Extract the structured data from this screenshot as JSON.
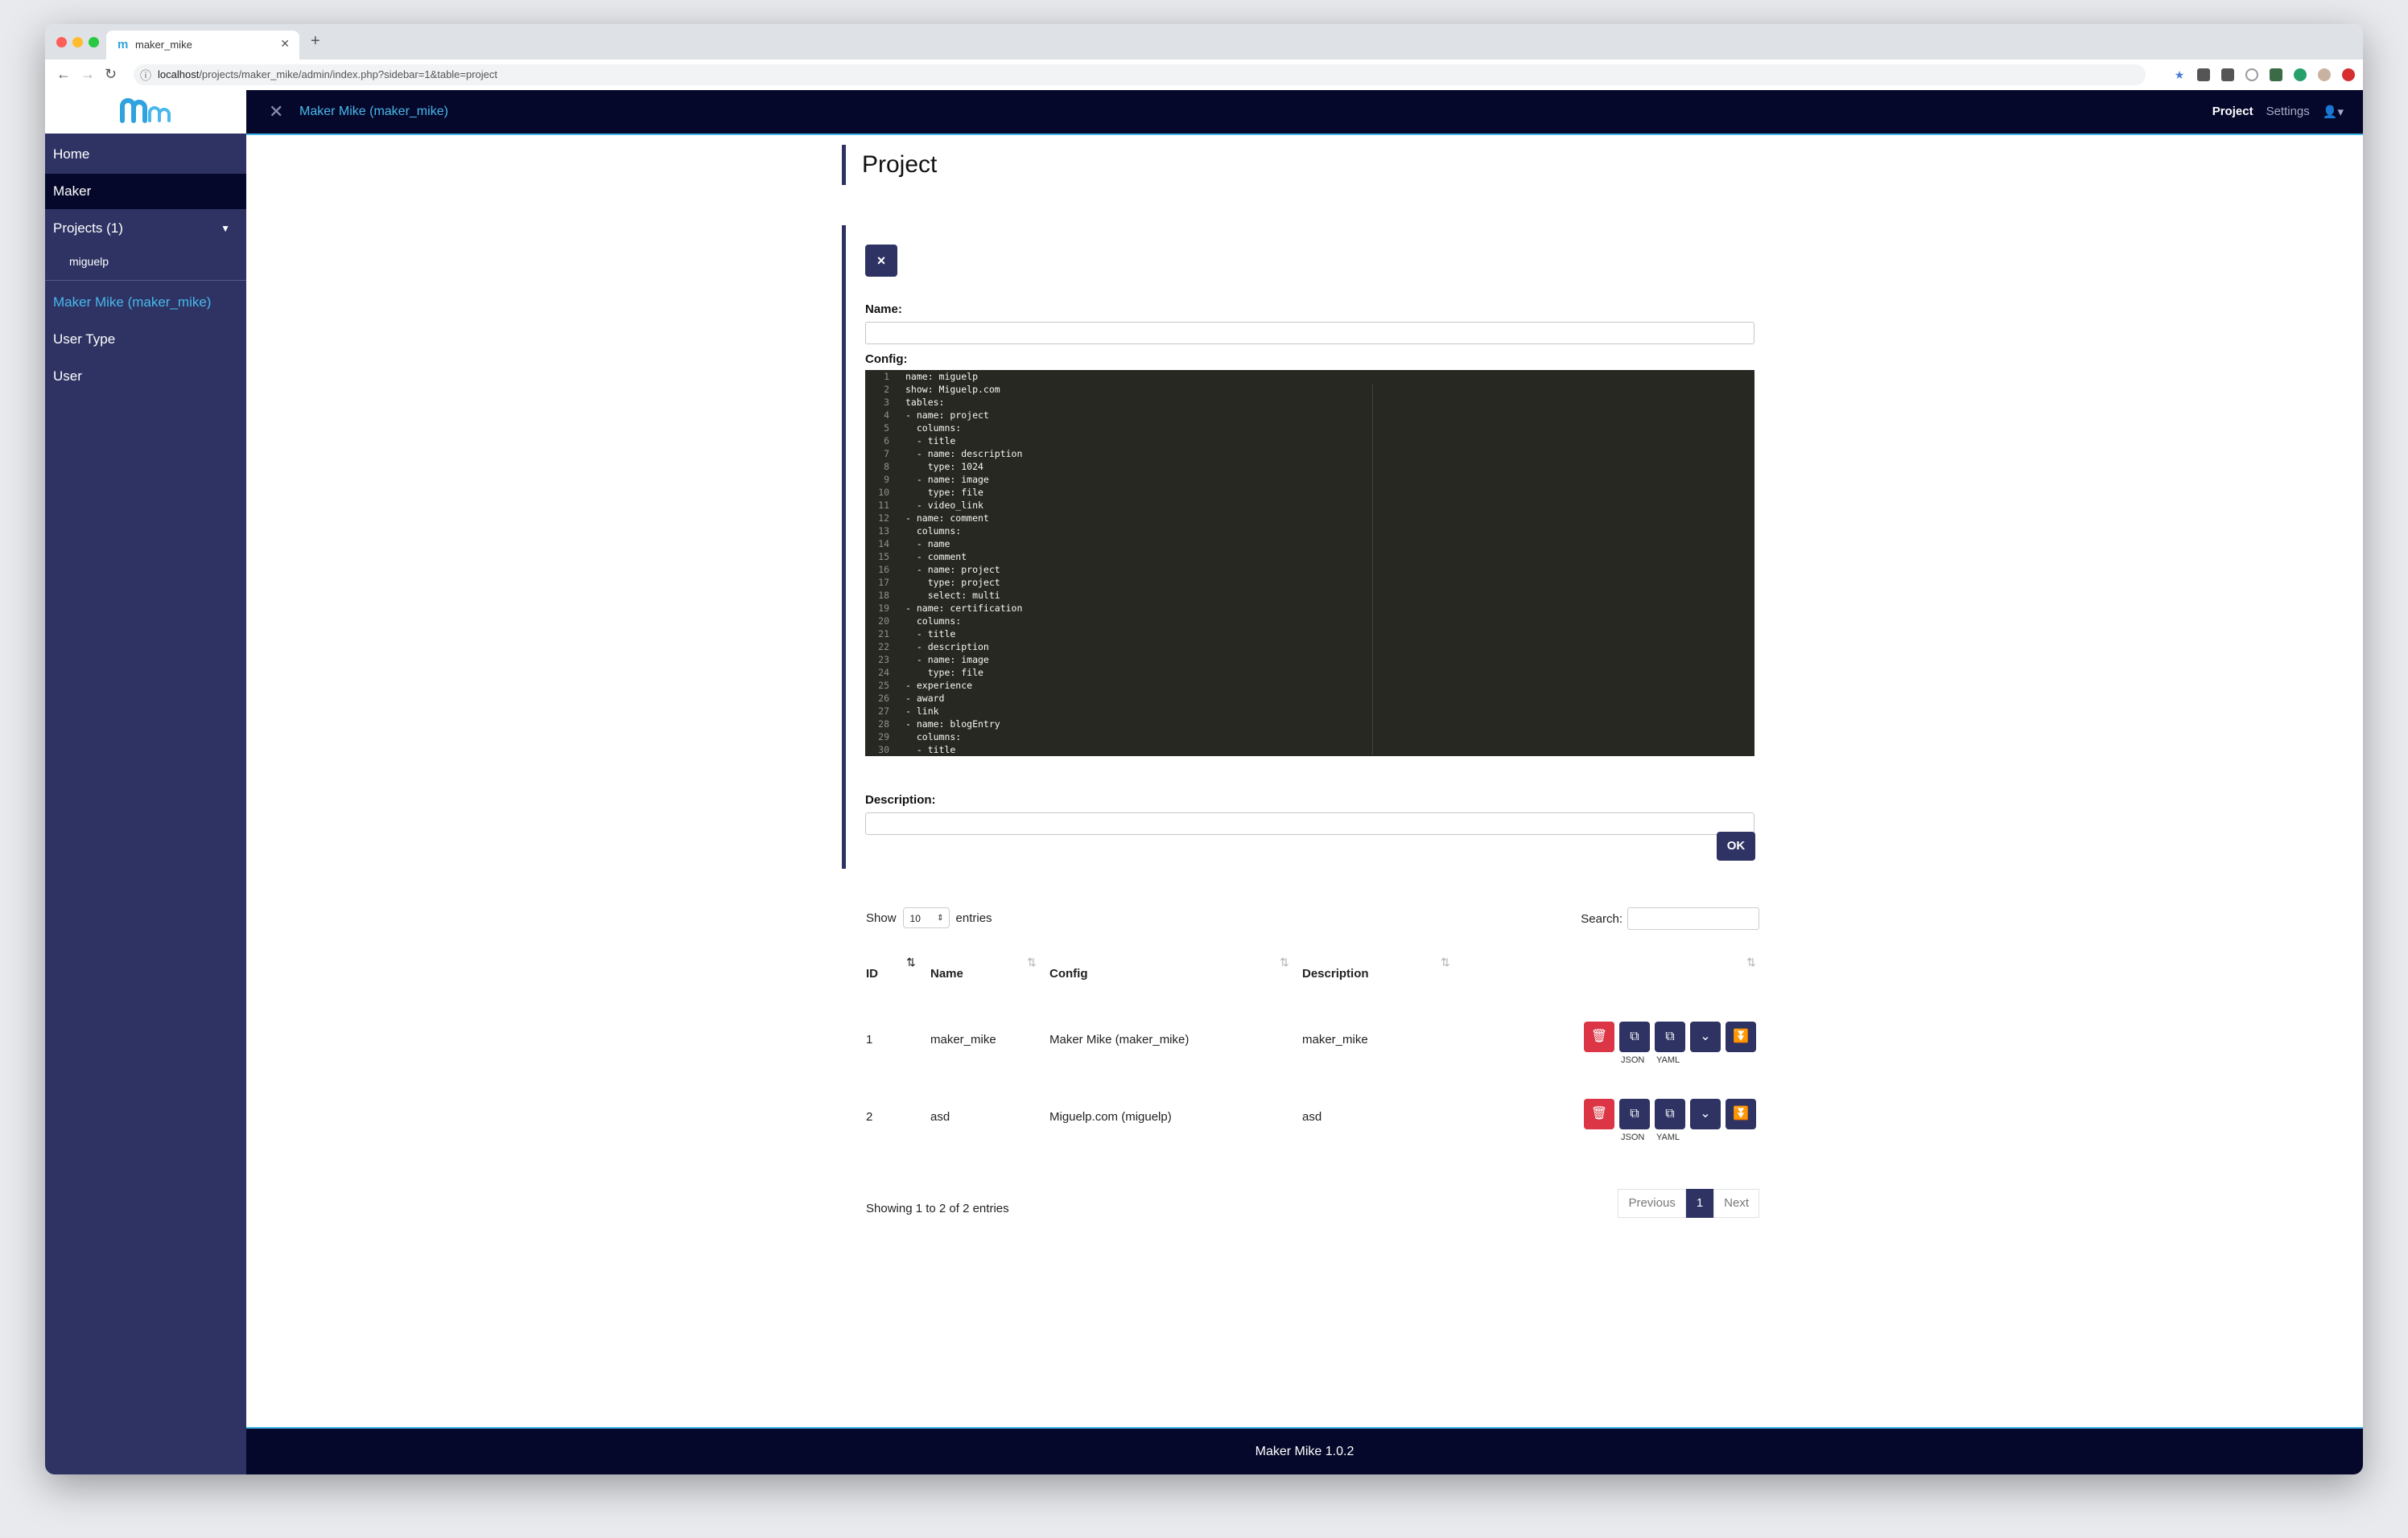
{
  "browser": {
    "tab_title": "maker_mike",
    "tab_favicon": "m",
    "url_host": "localhost",
    "url_path": "/projects/maker_mike/admin/index.php?sidebar=1&table=project",
    "new_tab": "+",
    "icons": [
      "back-icon",
      "forward-icon",
      "reload-icon",
      "info-icon",
      "star-icon",
      "extension-icon",
      "avatar-icon"
    ]
  },
  "sidebar": {
    "items": [
      {
        "label": "Home"
      },
      {
        "label": "Maker"
      },
      {
        "label": "Projects (1)"
      },
      {
        "label": "miguelp"
      },
      {
        "label": "Maker Mike (maker_mike)"
      },
      {
        "label": "User Type"
      },
      {
        "label": "User"
      }
    ]
  },
  "topbar": {
    "title": "Maker Mike (maker_mike)",
    "nav": [
      "Project",
      "Settings"
    ]
  },
  "form": {
    "page_title": "Project",
    "close_label": "×",
    "name_label": "Name:",
    "name_value": "",
    "config_label": "Config:",
    "description_label": "Description:",
    "description_value": "",
    "ok_label": "OK",
    "config_lines": [
      "name: miguelp",
      "show: Miguelp.com",
      "tables:",
      "- name: project",
      "  columns:",
      "  - title",
      "  - name: description",
      "    type: 1024",
      "  - name: image",
      "    type: file",
      "  - video_link",
      "- name: comment",
      "  columns:",
      "  - name",
      "  - comment",
      "  - name: project",
      "    type: project",
      "    select: multi",
      "- name: certification",
      "  columns:",
      "  - title",
      "  - description",
      "  - name: image",
      "    type: file",
      "- experience",
      "- award",
      "- link",
      "- name: blogEntry",
      "  columns:",
      "  - title"
    ],
    "line_numbers": [
      "1",
      "2",
      "3",
      "4",
      "5",
      "6",
      "7",
      "8",
      "9",
      "10",
      "11",
      "12",
      "13",
      "14",
      "15",
      "16",
      "17",
      "18",
      "19",
      "20",
      "21",
      "22",
      "23",
      "24",
      "25",
      "26",
      "27",
      "28",
      "29",
      "30"
    ]
  },
  "table": {
    "show_label": "Show",
    "entries_label": "entries",
    "page_length": "10",
    "search_label": "Search:",
    "columns": [
      "ID",
      "Name",
      "Config",
      "Description"
    ],
    "rows": [
      {
        "id": "1",
        "name": "maker_mike",
        "config": "Maker Mike (maker_mike)",
        "description": "maker_mike"
      },
      {
        "id": "2",
        "name": "asd",
        "config": "Miguelp.com (miguelp)",
        "description": "asd"
      }
    ],
    "action_captions": [
      "JSON",
      "YAML"
    ],
    "info": "Showing 1 to 2 of 2 entries",
    "pagination": {
      "previous": "Previous",
      "current": "1",
      "next": "Next"
    }
  },
  "footer": {
    "text": "Maker Mike 1.0.2"
  },
  "colors": {
    "navy": "#2e3363",
    "dark": "#05082a",
    "accent": "#48b8ec",
    "danger": "#dc3545",
    "editor_bg": "#272822"
  }
}
